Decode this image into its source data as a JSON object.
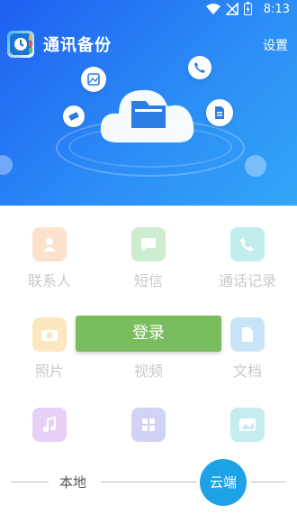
{
  "status_bar": {
    "time": "8:13"
  },
  "app_bar": {
    "title": "通讯备份",
    "settings_label": "设置"
  },
  "grid": {
    "items": [
      {
        "label": "联系人",
        "icon": "contact-icon",
        "color": "#f7a25a"
      },
      {
        "label": "短信",
        "icon": "sms-icon",
        "color": "#5cc66a"
      },
      {
        "label": "通话记录",
        "icon": "phone-icon",
        "color": "#36c6c6"
      },
      {
        "label": "照片",
        "icon": "camera-icon",
        "color": "#f5b133"
      },
      {
        "label": "视频",
        "icon": "video-icon",
        "color": "#e96d6d"
      },
      {
        "label": "文档",
        "icon": "document-icon",
        "color": "#4aa8e8"
      },
      {
        "label": "",
        "icon": "music-icon",
        "color": "#b26be2"
      },
      {
        "label": "",
        "icon": "apps-icon",
        "color": "#6b6fe2"
      },
      {
        "label": "",
        "icon": "image-icon",
        "color": "#43c1c8"
      }
    ]
  },
  "login_button": {
    "label": "登录",
    "color": "#79bd5f"
  },
  "bottom_tabs": {
    "local": "本地",
    "cloud": "云端",
    "active": "cloud",
    "active_color": "#1da2e8"
  }
}
